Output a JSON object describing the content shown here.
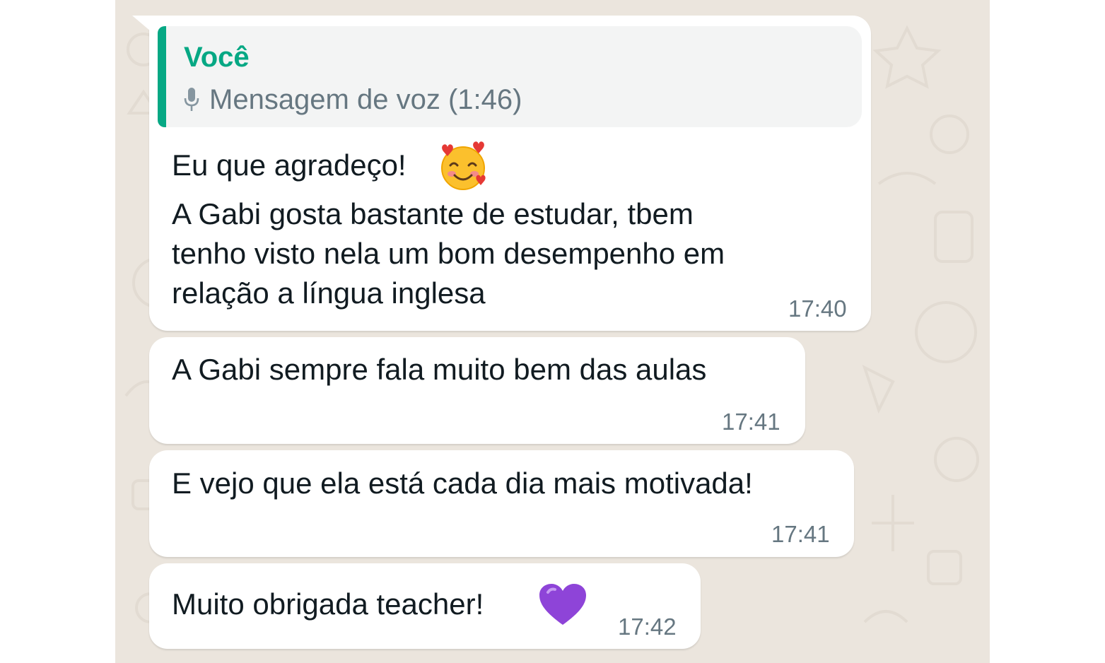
{
  "colors": {
    "chat_background": "#ebe5dd",
    "bubble": "#ffffff",
    "quote_accent": "#06a884",
    "quote_background": "#f3f4f4",
    "meta_text": "#667781",
    "message_text": "#111b21"
  },
  "messages": [
    {
      "reply": {
        "author": "Você",
        "icon": "microphone-icon",
        "text": "Mensagem de voz (1:46)"
      },
      "lines": [
        "Eu que agradeço!",
        "A Gabi gosta bastante de estudar, tbem",
        "tenho visto nela um bom desempenho em",
        "relação a língua inglesa"
      ],
      "emoji": "smiling-face-with-hearts-icon",
      "time": "17:40"
    },
    {
      "lines": [
        "A Gabi sempre fala muito bem das aulas"
      ],
      "time": "17:41"
    },
    {
      "lines": [
        "E vejo que ela está cada dia mais motivada!"
      ],
      "time": "17:41"
    },
    {
      "lines": [
        "Muito obrigada teacher!"
      ],
      "emoji": "purple-heart-icon",
      "time": "17:42"
    }
  ]
}
